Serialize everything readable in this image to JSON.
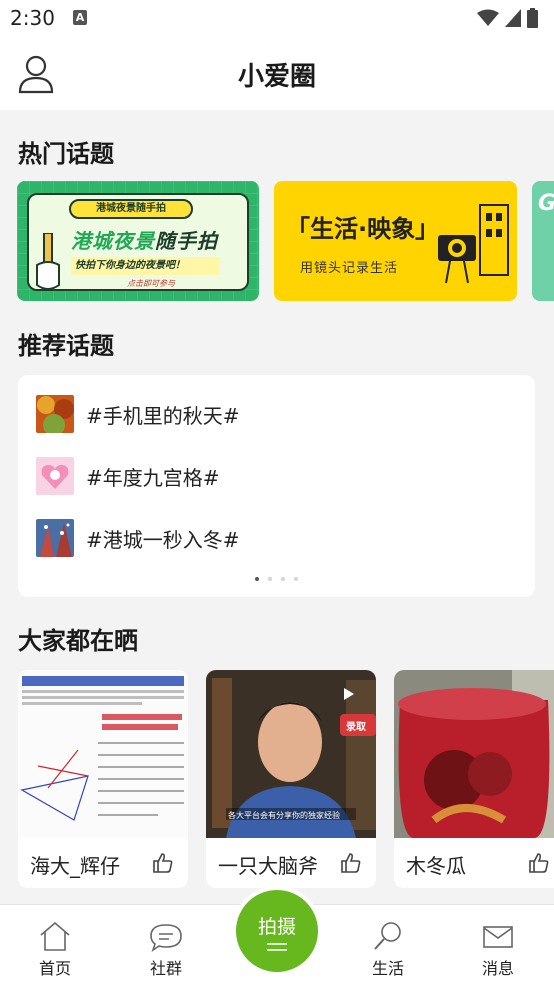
{
  "status_bar": {
    "time": "2:30",
    "notification_badge": "A"
  },
  "header": {
    "title": "小爱圈",
    "avatar_icon": "user-avatar-icon"
  },
  "hot_topics": {
    "title": "热门话题",
    "banners": [
      {
        "pill": "港城夜景随手拍",
        "title_highlight": "港城夜景",
        "title_rest": "随手拍",
        "subtitle": "快拍下你身边的夜景吧！",
        "footer": "点击即可参与"
      },
      {
        "title": "「生活·映象」",
        "subtitle": "用镜头记录生活"
      },
      {
        "title": "G"
      }
    ]
  },
  "recommended_topics": {
    "title": "推荐话题",
    "items": [
      {
        "label": "#手机里的秋天#"
      },
      {
        "label": "#年度九宫格#"
      },
      {
        "label": "#港城一秒入冬#"
      }
    ],
    "page_count": 4,
    "active_page": 0
  },
  "everyone_sharing": {
    "title": "大家都在晒",
    "posts": [
      {
        "author": "海大_辉仔"
      },
      {
        "author": "一只大脑斧",
        "video_caption": "各大平台会有分享你的独家经验",
        "button": "录取"
      },
      {
        "author": "木冬瓜"
      }
    ]
  },
  "tab_bar": {
    "tabs": [
      {
        "label": "首页",
        "icon": "home-icon"
      },
      {
        "label": "社群",
        "icon": "chat-bubble-icon"
      },
      {
        "label": "生活",
        "icon": "search-icon"
      },
      {
        "label": "消息",
        "icon": "mail-icon"
      }
    ],
    "shoot_label": "拍摄"
  },
  "colors": {
    "accent_green": "#67b81e",
    "banner_green": "#2fb56a",
    "banner_yellow": "#ffd400"
  }
}
